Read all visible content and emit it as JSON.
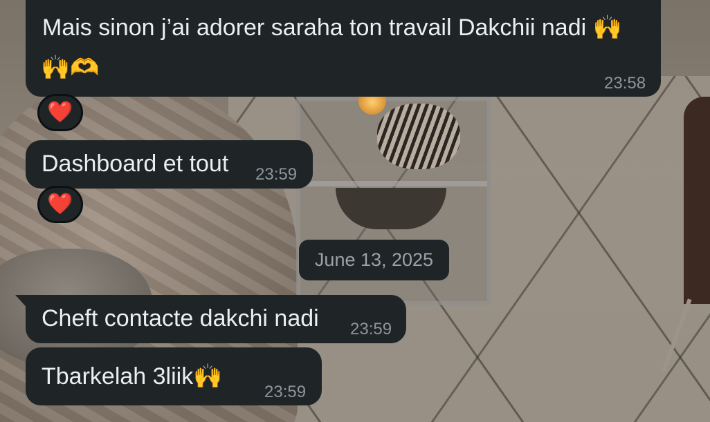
{
  "messages": [
    {
      "line1": "Mais sinon j’ai adorer saraha ton travail Dakchii nadi",
      "line1_emoji": "🙌",
      "line2_emoji": "🙌🫶",
      "time": "23:58",
      "reaction": "❤️"
    },
    {
      "text": "Dashboard et tout",
      "time": "23:59",
      "reaction": "❤️"
    },
    {
      "text": "Cheft contacte dakchi nadi",
      "time": "23:59"
    },
    {
      "text": "Tbarkelah 3liik",
      "emoji": "🙌",
      "time": "23:59"
    }
  ],
  "date_separator": "June 13, 2025",
  "colors": {
    "bubble_bg": "#1f2527",
    "text": "#eceeef",
    "timestamp": "#8c969a",
    "reaction_heart": "#e8203c"
  }
}
